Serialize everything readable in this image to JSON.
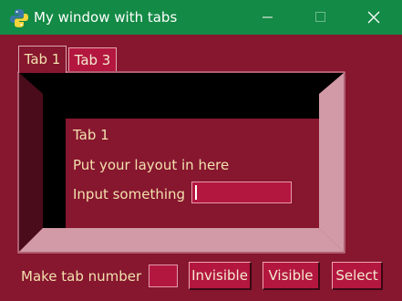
{
  "window": {
    "title": "My window with tabs",
    "controls": [
      "minimize-icon",
      "maximize-icon",
      "close-icon"
    ]
  },
  "tabs": [
    {
      "label": "Tab 1",
      "selected": true
    },
    {
      "label": "Tab 3",
      "selected": false
    }
  ],
  "tab_content": {
    "heading": "Tab 1",
    "message": "Put your layout in here",
    "input_label": "Input something",
    "input_value": ""
  },
  "footer": {
    "label": "Make tab number",
    "tab_number_value": "",
    "invisible_label": "Invisible",
    "visible_label": "Visible",
    "select_label": "Select"
  },
  "colors": {
    "titlebar": "#138a45",
    "background": "#87162f",
    "text": "#f2e1ad",
    "input_bg": "#b3173f",
    "button_bg": "#b3173f",
    "frame_dark": "#000000",
    "frame_mid": "#4a0b1a",
    "frame_light": "#d29aa6"
  }
}
